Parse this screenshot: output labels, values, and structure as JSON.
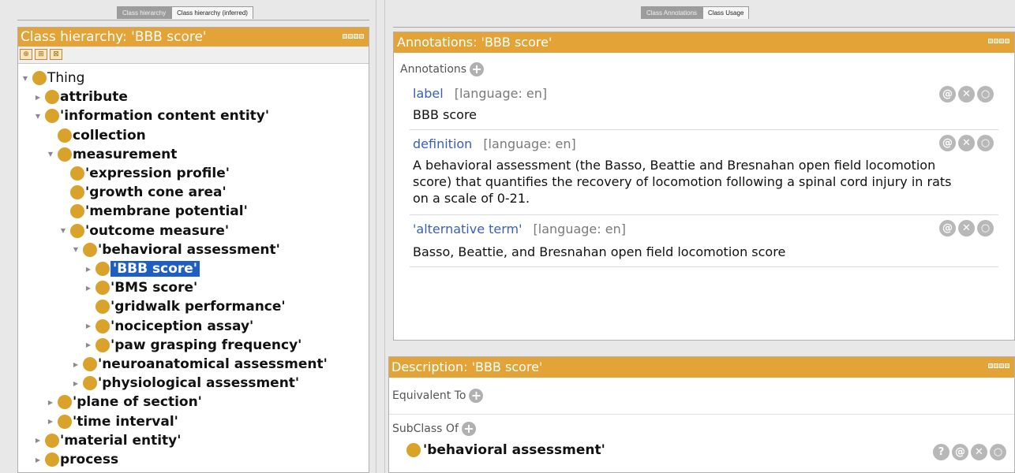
{
  "left_panel": {
    "tabs": [
      "Class hierarchy",
      "Class hierarchy (inferred)"
    ],
    "header": "Class hierarchy: 'BBB score'",
    "toolbar_icons": [
      "add-subclass-icon",
      "add-sibling-icon",
      "delete-class-icon"
    ],
    "tree": [
      {
        "label": "Thing",
        "depth": 0,
        "twisty": "open",
        "bold": false
      },
      {
        "label": "attribute",
        "depth": 1,
        "twisty": "closed",
        "bold": true
      },
      {
        "label": "'information content entity'",
        "depth": 1,
        "twisty": "open",
        "bold": true
      },
      {
        "label": "collection",
        "depth": 2,
        "twisty": "none",
        "bold": true
      },
      {
        "label": "measurement",
        "depth": 2,
        "twisty": "open",
        "bold": true
      },
      {
        "label": "'expression profile'",
        "depth": 3,
        "twisty": "none",
        "bold": true
      },
      {
        "label": "'growth cone area'",
        "depth": 3,
        "twisty": "none",
        "bold": true
      },
      {
        "label": "'membrane potential'",
        "depth": 3,
        "twisty": "none",
        "bold": true
      },
      {
        "label": "'outcome measure'",
        "depth": 3,
        "twisty": "open",
        "bold": true
      },
      {
        "label": "'behavioral assessment'",
        "depth": 4,
        "twisty": "open",
        "bold": true
      },
      {
        "label": "'BBB score'",
        "depth": 5,
        "twisty": "closed",
        "bold": true,
        "selected": true
      },
      {
        "label": "'BMS score'",
        "depth": 5,
        "twisty": "closed",
        "bold": true
      },
      {
        "label": "'gridwalk performance'",
        "depth": 5,
        "twisty": "none",
        "bold": true
      },
      {
        "label": "'nociception assay'",
        "depth": 5,
        "twisty": "closed",
        "bold": true
      },
      {
        "label": "'paw grasping frequency'",
        "depth": 5,
        "twisty": "closed",
        "bold": true
      },
      {
        "label": "'neuroanatomical assessment'",
        "depth": 4,
        "twisty": "closed",
        "bold": true
      },
      {
        "label": "'physiological assessment'",
        "depth": 4,
        "twisty": "closed",
        "bold": true
      },
      {
        "label": "'plane of section'",
        "depth": 2,
        "twisty": "closed",
        "bold": true
      },
      {
        "label": "'time interval'",
        "depth": 2,
        "twisty": "closed",
        "bold": true
      },
      {
        "label": "'material entity'",
        "depth": 1,
        "twisty": "closed",
        "bold": true
      },
      {
        "label": "process",
        "depth": 1,
        "twisty": "closed",
        "bold": true
      }
    ]
  },
  "right_panel": {
    "tabs": [
      "Class Annotations",
      "Class Usage"
    ],
    "annotations": {
      "header": "Annotations: 'BBB score'",
      "section_label": "Annotations",
      "items": [
        {
          "property": "label",
          "lang": "[language: en]",
          "value": "BBB score"
        },
        {
          "property": "definition",
          "lang": "[language: en]",
          "value": "A behavioral assessment (the Basso, Beattie and Bresnahan open field locomotion score) that quantifies the recovery of locomotion following a spinal cord injury in rats on a scale of 0-21."
        },
        {
          "property": "'alternative term'",
          "lang": "[language: en]",
          "value": "Basso, Beattie, and Bresnahan open field locomotion score"
        }
      ]
    },
    "description": {
      "header": "Description: 'BBB score'",
      "equivalent_to": "Equivalent To",
      "subclass_of": "SubClass Of",
      "subclass_value": "'behavioral assessment'"
    }
  },
  "colors": {
    "header_orange": "#e3a336",
    "class_ball": "#d9a22b",
    "selection_blue": "#1f5fc4",
    "property_blue": "#3a5fb4"
  }
}
